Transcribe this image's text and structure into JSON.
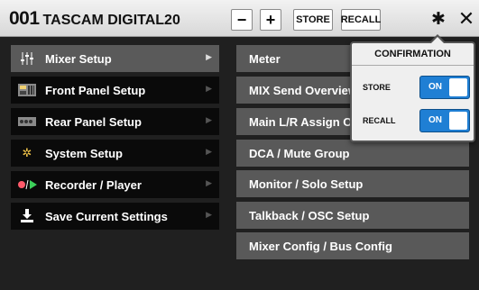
{
  "header": {
    "number": "001",
    "name": "TASCAM DIGITAL20",
    "minus_label": "−",
    "plus_label": "+",
    "store_label": "STORE",
    "recall_label": "RECALL"
  },
  "left_menu": [
    {
      "label": "Mixer Setup",
      "icon": "mixer-faders-icon",
      "active": true
    },
    {
      "label": "Front Panel Setup",
      "icon": "front-panel-icon",
      "active": false
    },
    {
      "label": "Rear Panel Setup",
      "icon": "rear-panel-icon",
      "active": false
    },
    {
      "label": "System Setup",
      "icon": "system-gears-icon",
      "active": false
    },
    {
      "label": "Recorder / Player",
      "icon": "record-play-icon",
      "active": false
    },
    {
      "label": "Save Current Settings",
      "icon": "save-download-icon",
      "active": false
    }
  ],
  "right_menu": [
    {
      "label": "Meter"
    },
    {
      "label": "MIX Send Overview"
    },
    {
      "label": "Main L/R Assign Overview"
    },
    {
      "label": "DCA / Mute Group"
    },
    {
      "label": "Monitor / Solo Setup"
    },
    {
      "label": "Talkback / OSC Setup"
    },
    {
      "label": "Mixer Config / Bus Config"
    }
  ],
  "confirmation": {
    "title": "CONFIRMATION",
    "rows": [
      {
        "label": "STORE",
        "state": "ON"
      },
      {
        "label": "RECALL",
        "state": "ON"
      }
    ]
  },
  "colors": {
    "toggle_on": "#1f7fd4",
    "menu_bg": "#595959",
    "left_bg": "#0a0a0a"
  }
}
